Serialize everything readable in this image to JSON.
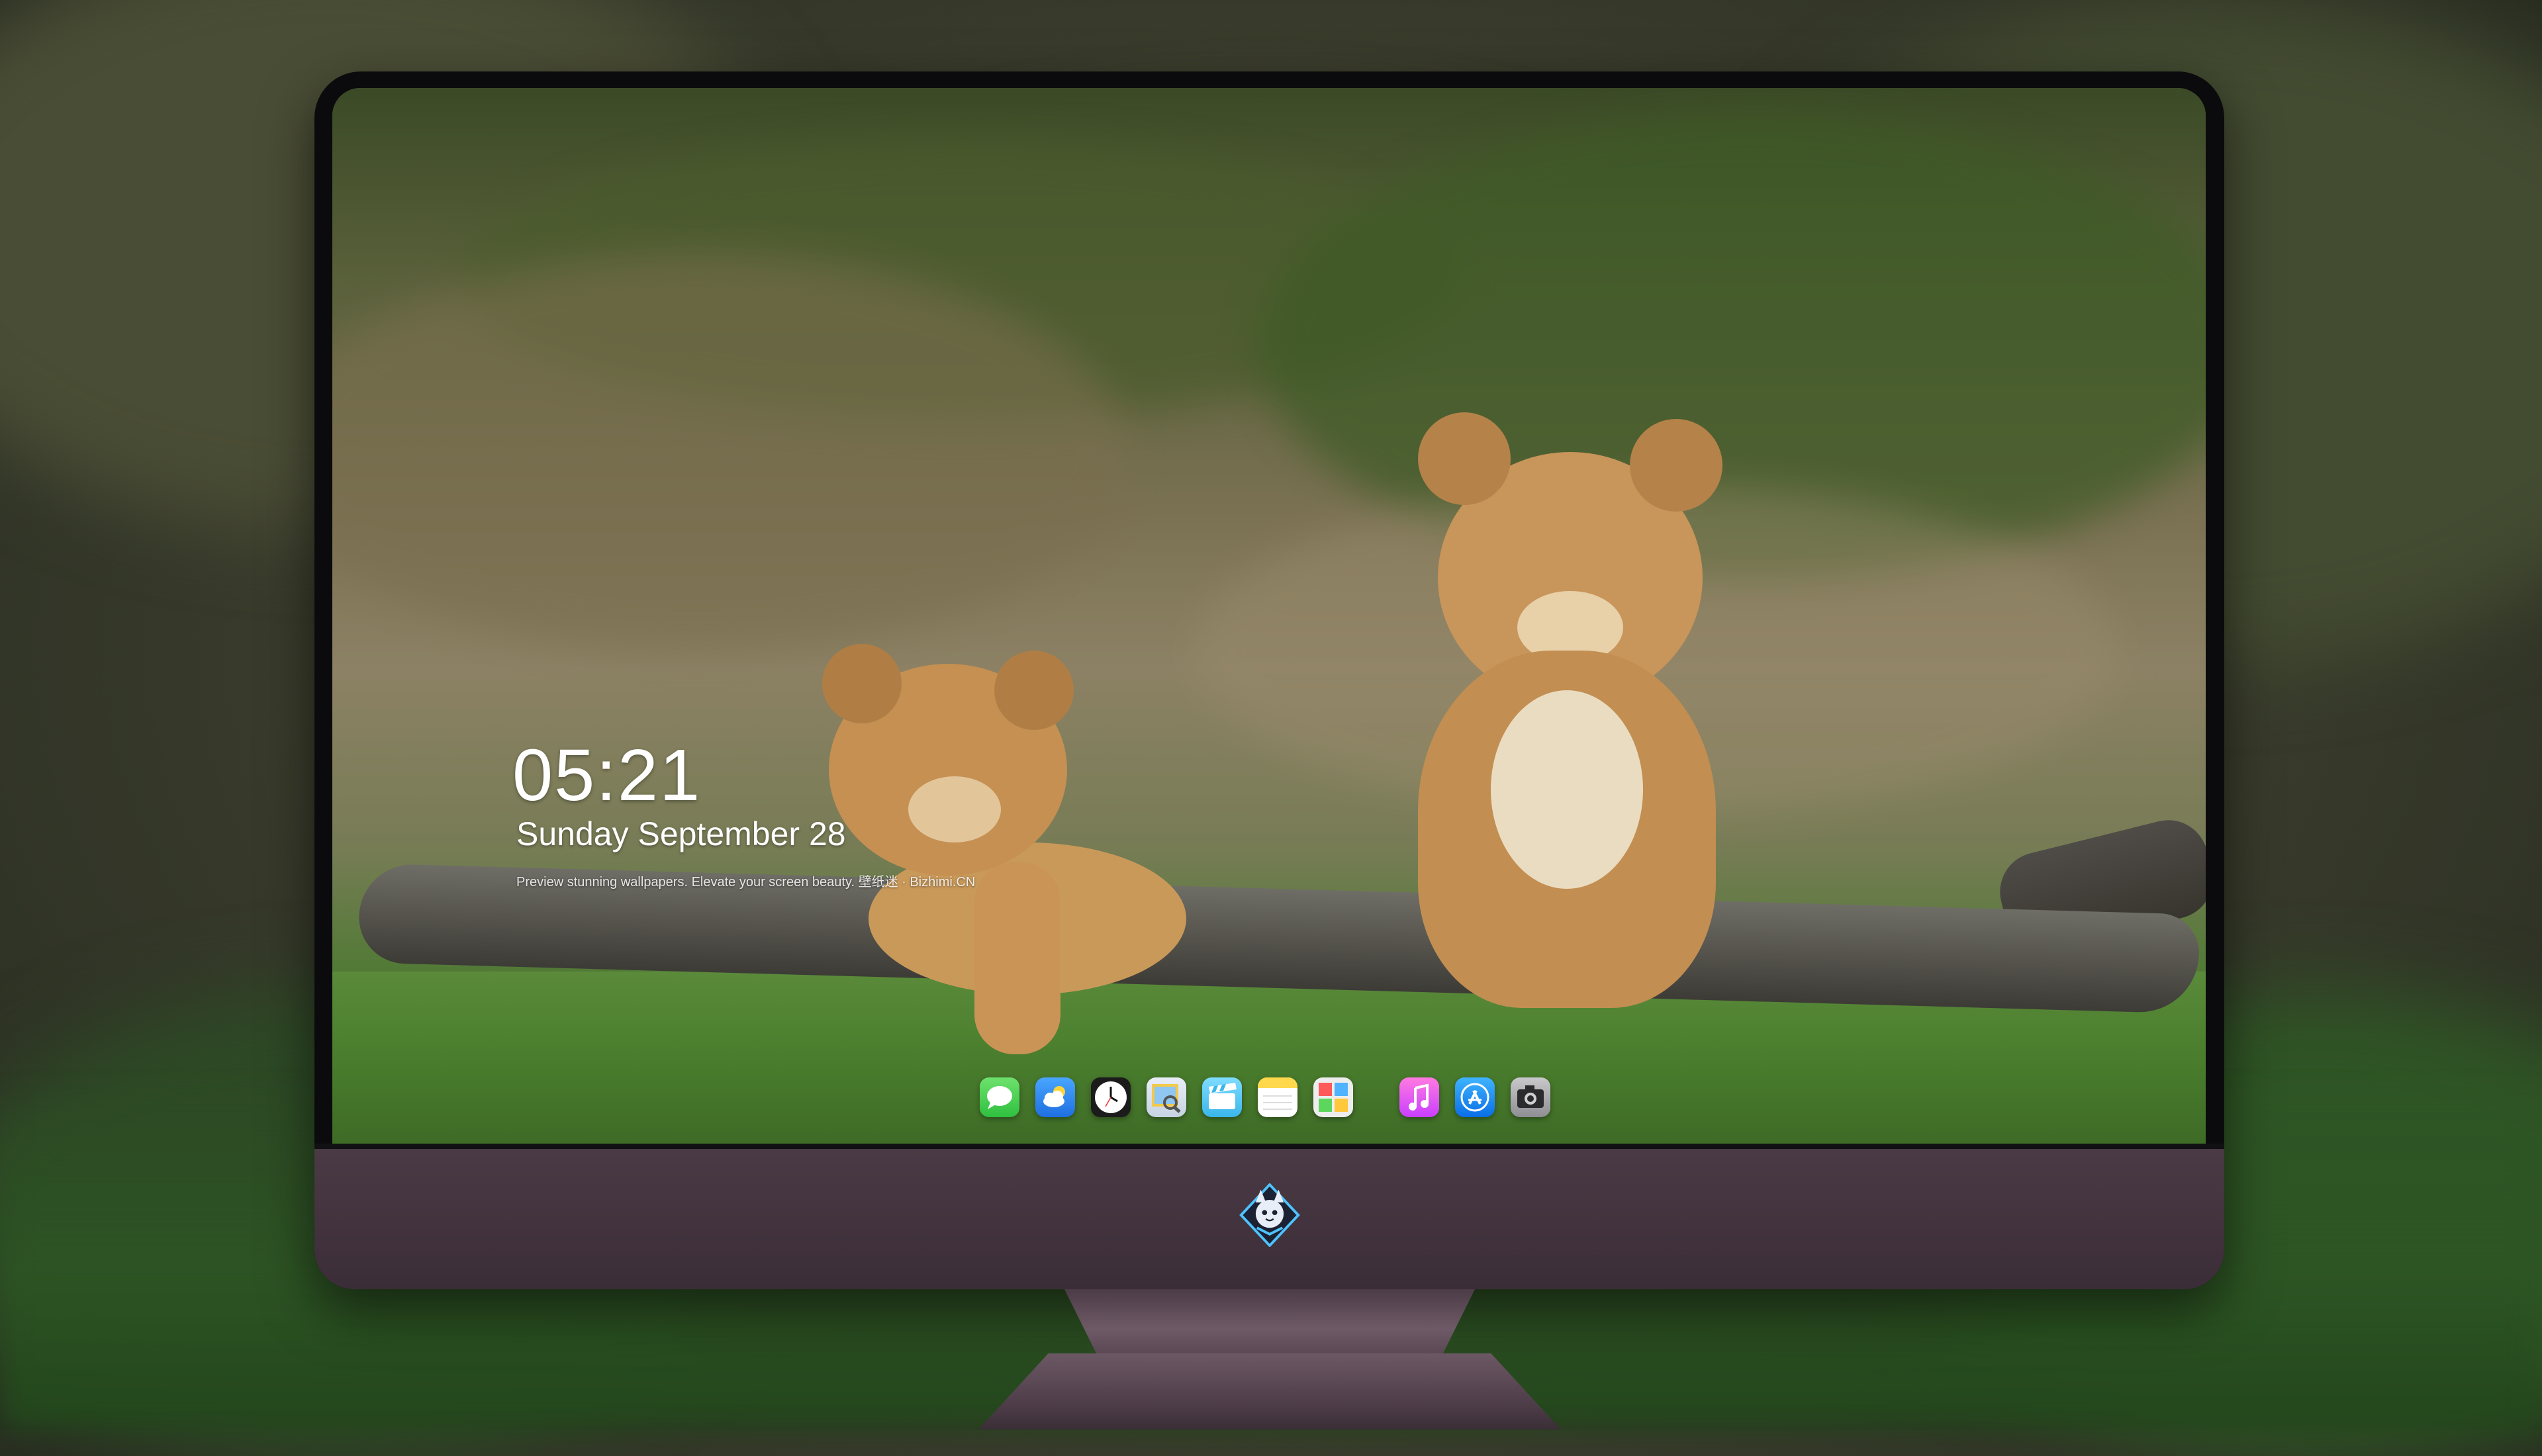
{
  "lock_screen": {
    "time": "05:21",
    "date": "Sunday September  28",
    "caption": "Preview stunning wallpapers. Elevate your screen beauty. 壁纸迷 · Bizhimi.CN"
  },
  "dock": {
    "apps": [
      {
        "name": "messages-icon",
        "color": "#34c759"
      },
      {
        "name": "weather-icon",
        "color": "#2f8cff"
      },
      {
        "name": "clock-icon",
        "color": "#ffffff"
      },
      {
        "name": "preview-icon",
        "color": "#f2c94c"
      },
      {
        "name": "clips-icon",
        "color": "#5ac8fa"
      },
      {
        "name": "notes-icon",
        "color": "#ffd84d"
      },
      {
        "name": "photo-booth-icon",
        "color": "#e6e6e6"
      },
      {
        "name": "music-icon",
        "color": "#ff5ec8"
      },
      {
        "name": "app-store-icon",
        "color": "#1a8cff"
      },
      {
        "name": "camera-icon",
        "color": "#8e8e93"
      }
    ]
  },
  "monitor": {
    "chin_logo": "fox-mascot-logo-icon"
  }
}
